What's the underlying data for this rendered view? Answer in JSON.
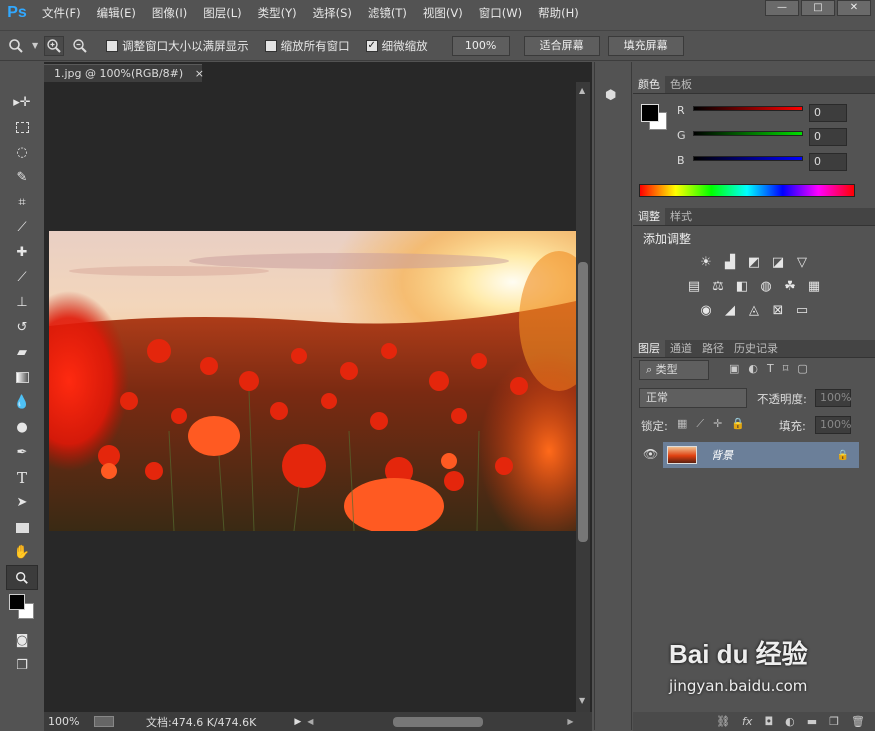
{
  "app": {
    "logo": "Ps"
  },
  "menu": [
    "文件(F)",
    "编辑(E)",
    "图像(I)",
    "图层(L)",
    "类型(Y)",
    "选择(S)",
    "滤镜(T)",
    "视图(V)",
    "窗口(W)",
    "帮助(H)"
  ],
  "window_controls": [
    "—",
    "□",
    "✕"
  ],
  "options": {
    "resize_windows_label": "调整窗口大小以满屏显示",
    "zoom_all_label": "缩放所有窗口",
    "scrubby_zoom_label": "细微缩放",
    "scrubby_checked": "✓",
    "zoom_100_label": "100%",
    "fit_screen_label": "适合屏幕",
    "fill_screen_label": "填充屏幕"
  },
  "document": {
    "tab_title": "1.jpg @ 100%(RGB/8#)",
    "tab_close": "×",
    "zoom": "100%",
    "doc_info": "文档:474.6 K/474.6K"
  },
  "color_panel": {
    "tabs": [
      "颜色",
      "色板"
    ],
    "channels": [
      {
        "label": "R",
        "value": "0",
        "color": "#ff0000"
      },
      {
        "label": "G",
        "value": "0",
        "color": "#00dd00"
      },
      {
        "label": "B",
        "value": "0",
        "color": "#0000ff"
      }
    ]
  },
  "adjust_panel": {
    "tabs": [
      "调整",
      "样式"
    ],
    "title": "添加调整"
  },
  "layers_panel": {
    "tabs": [
      "图层",
      "通道",
      "路径",
      "历史记录"
    ],
    "filter_label": "类型",
    "blend_mode": "正常",
    "opacity_label": "不透明度:",
    "opacity_value": "100%",
    "lock_label": "锁定:",
    "fill_label": "填充:",
    "fill_value": "100%",
    "layer_name": "背景"
  },
  "colors": {
    "accent": "#31a8ff",
    "selected_layer": "#6b7f99"
  },
  "watermark": {
    "brand": "Bai du 经验",
    "url": "jingyan.baidu.com"
  }
}
